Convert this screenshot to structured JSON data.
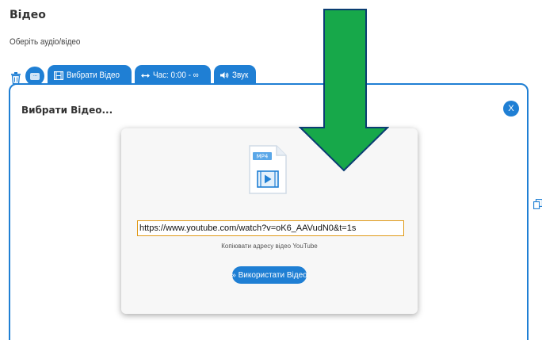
{
  "header": {
    "title": "Відео",
    "subtitle": "Оберіть аудіо/відео"
  },
  "toolbar": {
    "delete_icon": "trash-icon",
    "media_icon": "media-toggle-icon",
    "choose_video_label": "Вибрати Відео",
    "time_label": "Час: 0:00 - ∞",
    "sound_label": "Звук"
  },
  "panel": {
    "title": "Вибрати Відео...",
    "close_label": "X"
  },
  "dialog": {
    "file_badge": "MP4",
    "url_value": "https://www.youtube.com/watch?v=oK6_AAVudN0&t=1s",
    "hint": "Копіювати адресу відео YouTube",
    "use_button_label": "» Використати Відео"
  },
  "colors": {
    "accent": "#1f7fd4",
    "arrow": "#17a84a",
    "input_border": "#e09a18"
  }
}
